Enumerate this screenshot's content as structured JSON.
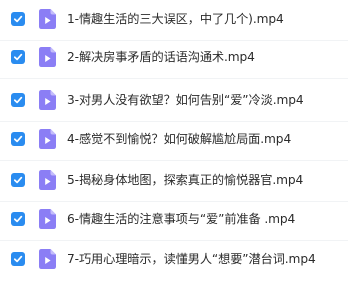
{
  "files": [
    {
      "name": "1-情趣生活的三大误区，中了几个).mp4",
      "checked": true,
      "icon": "video-file-icon"
    },
    {
      "name": "2-解决房事矛盾的话语沟通术.mp4",
      "checked": true,
      "icon": "video-file-icon"
    },
    {
      "name": "3-对男人没有欲望？如何告别“爱”冷淡.mp4",
      "checked": true,
      "icon": "video-file-icon"
    },
    {
      "name": "4-感觉不到愉悦？如何破解尴尬局面.mp4",
      "checked": true,
      "icon": "video-file-icon"
    },
    {
      "name": "5-揭秘身体地图，探索真正的愉悦器官.mp4",
      "checked": true,
      "icon": "video-file-icon"
    },
    {
      "name": "6-情趣生活的注意事项与“爱”前准备 .mp4",
      "checked": true,
      "icon": "video-file-icon"
    },
    {
      "name": "7-巧用心理暗示，读懂男人“想要”潜台词.mp4",
      "checked": true,
      "icon": "video-file-icon"
    }
  ],
  "colors": {
    "checkbox": "#2a8cf0",
    "file_icon": "#8b7ef5",
    "file_icon_fold": "#c4bcfb",
    "text": "#2b2b2b"
  }
}
